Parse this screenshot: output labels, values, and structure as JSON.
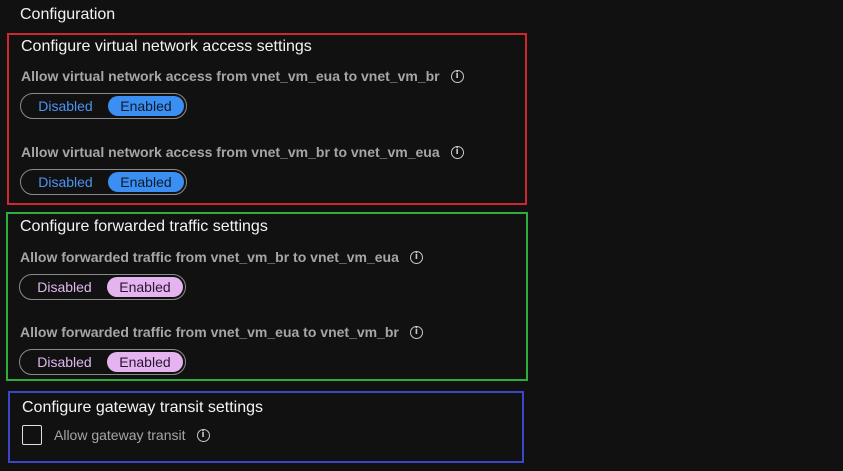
{
  "page": {
    "title": "Configuration"
  },
  "vnet_access": {
    "title": "Configure virtual network access settings",
    "border_color": "#d0262f",
    "fields": [
      {
        "label": "Allow virtual network access from vnet_vm_eua to vnet_vm_br",
        "options": [
          "Disabled",
          "Enabled"
        ],
        "selected": "Enabled",
        "info_icon": "info-icon"
      },
      {
        "label": "Allow virtual network access from vnet_vm_br to vnet_vm_eua",
        "options": [
          "Disabled",
          "Enabled"
        ],
        "selected": "Enabled",
        "info_icon": "info-icon"
      }
    ]
  },
  "forwarded_traffic": {
    "title": "Configure forwarded traffic settings",
    "border_color": "#2eac3c",
    "fields": [
      {
        "label": "Allow forwarded traffic from vnet_vm_br to vnet_vm_eua",
        "options": [
          "Disabled",
          "Enabled"
        ],
        "selected": "Enabled",
        "info_icon": "info-icon"
      },
      {
        "label": "Allow forwarded traffic from vnet_vm_eua to vnet_vm_br",
        "options": [
          "Disabled",
          "Enabled"
        ],
        "selected": "Enabled",
        "info_icon": "info-icon"
      }
    ]
  },
  "gateway_transit": {
    "title": "Configure gateway transit settings",
    "border_color": "#3d46c8",
    "checkbox": {
      "label": "Allow gateway transit",
      "checked": false,
      "info_icon": "info-icon"
    }
  },
  "colors": {
    "background": "#111111",
    "toggle_blue": "#3b8ff3",
    "toggle_pink": "#e4b3f0"
  }
}
